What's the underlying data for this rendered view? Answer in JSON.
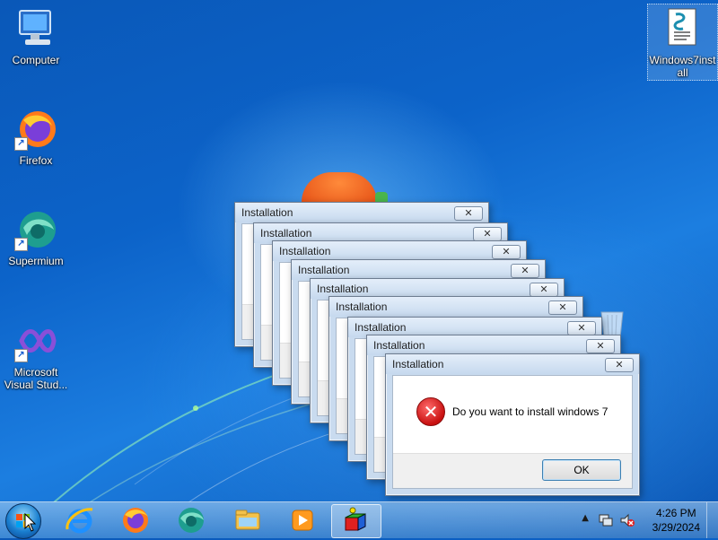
{
  "desktop": {
    "icons": [
      {
        "label": "Computer"
      },
      {
        "label": "Firefox"
      },
      {
        "label": "Supermium"
      },
      {
        "label": "Microsoft Visual Stud..."
      },
      {
        "label": "Windows7install"
      }
    ]
  },
  "dialogs": [
    {
      "title": "Installation"
    },
    {
      "title": "Installation"
    },
    {
      "title": "Installation"
    },
    {
      "title": "Installation"
    },
    {
      "title": "Installation"
    },
    {
      "title": "Installation"
    },
    {
      "title": "Installation"
    },
    {
      "title": "Installation"
    },
    {
      "title": "Installation",
      "message": "Do you want to install windows 7",
      "ok_label": "OK",
      "close_glyph": "✕"
    }
  ],
  "taskbar": {
    "items": [
      "start-button",
      "internet-explorer-icon",
      "firefox-icon",
      "supermium-icon",
      "file-explorer-icon",
      "media-player-icon",
      "active-app-icon"
    ],
    "clock": {
      "time": "4:26 PM",
      "date": "3/29/2024"
    },
    "tray": [
      "show-hidden-icons-icon",
      "network-icon",
      "volume-muted-icon"
    ]
  },
  "colors": {
    "accent": "#0c63c9",
    "error": "#c81010"
  }
}
